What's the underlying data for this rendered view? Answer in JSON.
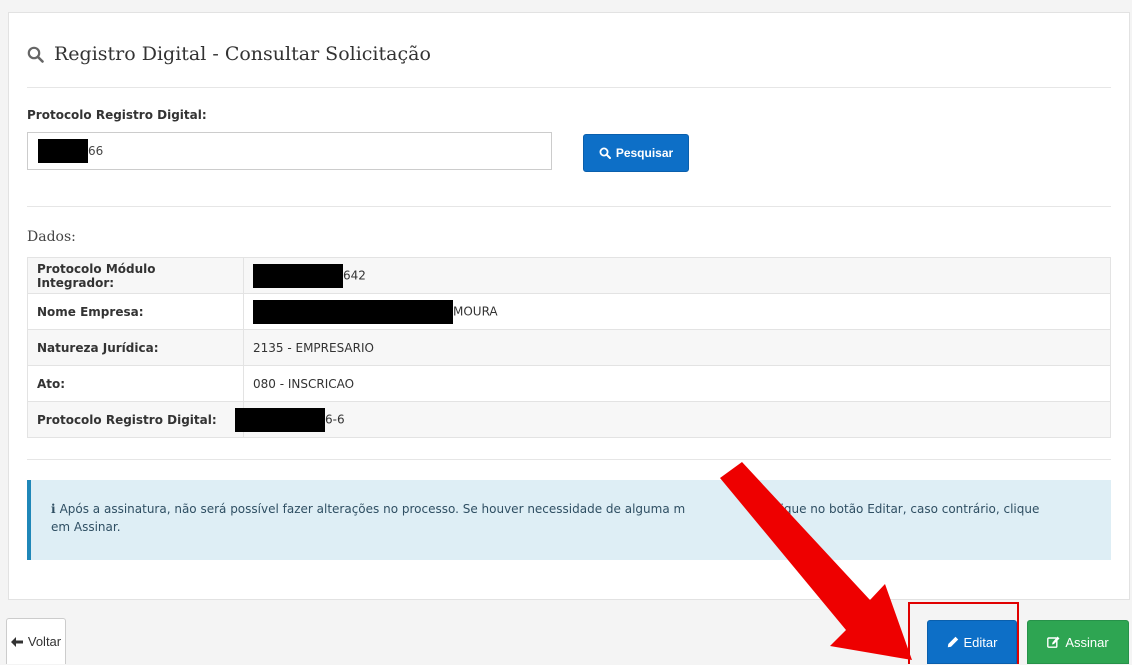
{
  "page": {
    "title": "Registro Digital - Consultar Solicitação"
  },
  "search": {
    "label": "Protocolo Registro Digital:",
    "value_visible": "66",
    "button_label": "Pesquisar"
  },
  "details": {
    "section_title": "Dados:",
    "rows": [
      {
        "label": "Protocolo Módulo Integrador:",
        "value_visible": "642"
      },
      {
        "label": "Nome Empresa:",
        "value_visible": "MOURA"
      },
      {
        "label": "Natureza Jurídica:",
        "value": "2135 - EMPRESARIO"
      },
      {
        "label": "Ato:",
        "value": "080 - INSCRICAO"
      },
      {
        "label": "Protocolo Registro Digital:",
        "value_visible": "6-6"
      }
    ]
  },
  "alert": {
    "icon": "info-icon",
    "text_line1": "Após a assinatura, não será possível fazer alterações no processo. Se houver necessidade de alguma m",
    "text_line1_tail": "lique no botão Editar, caso contrário, clique",
    "text_line2": "em Assinar."
  },
  "footer": {
    "back_label": "Voltar",
    "edit_label": "Editar",
    "sign_label": "Assinar"
  },
  "colors": {
    "primary": "#0d6fc7",
    "success": "#2ea552",
    "alert_bg": "#deeef5",
    "alert_border": "#1f87b8",
    "annotation_red": "#e00000"
  },
  "icons": {
    "title": "search-icon",
    "search_button": "search-icon",
    "back": "arrow-left-icon",
    "edit": "pencil-icon",
    "sign": "edit-square-icon"
  }
}
